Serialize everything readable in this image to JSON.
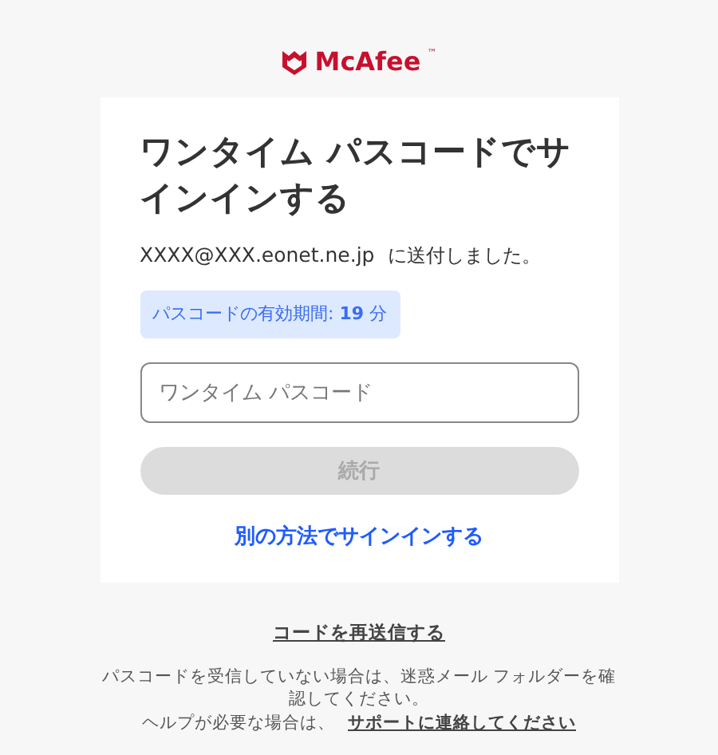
{
  "logo": {
    "text": "McAfee",
    "mark": "™"
  },
  "card": {
    "title": "ワンタイム パスコードでサインインする",
    "email": "XXXX@XXX.eonet.ne.jp",
    "sent_text": "に送付しました。",
    "expiry_badge": "パスコードの有効期間: **19** 分",
    "passcode_field": {
      "placeholder": "ワンタイム パスコード"
    },
    "continue_button": {
      "label": "続行",
      "disabled": true
    },
    "alt_link": "別の方法でサインインする"
  },
  "resend_link": "コードを再送信する",
  "help_text": "パスコードを受信していない場合は、迷惑メール フォルダーを確認してください。",
  "help_prefix": "ヘルプが必要な場合は、",
  "support_link": "サポートに連絡してください"
}
